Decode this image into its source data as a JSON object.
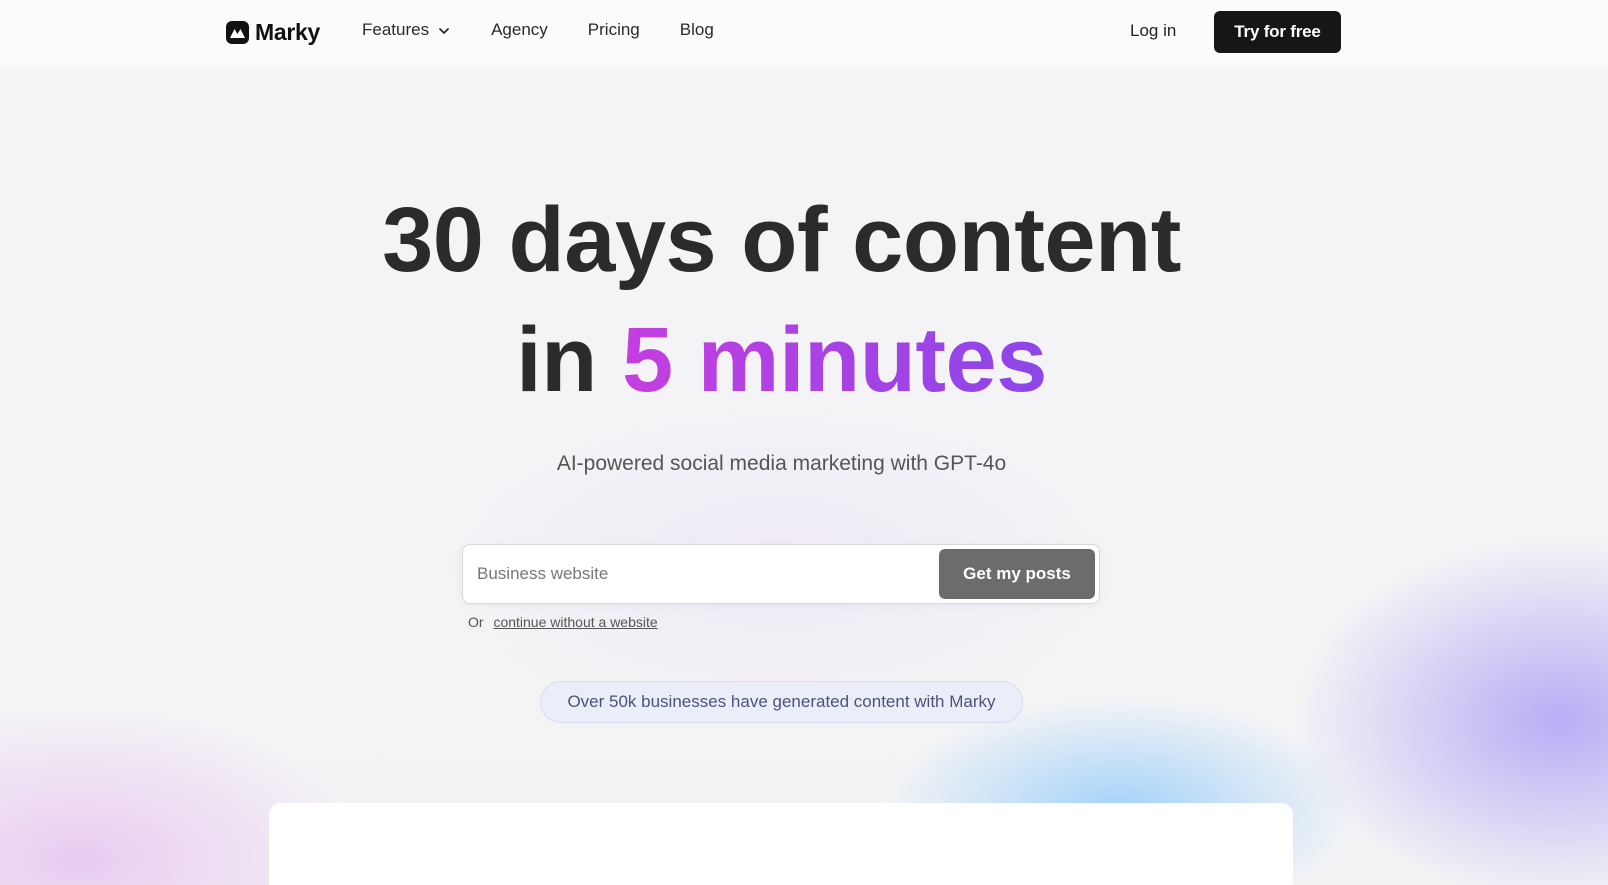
{
  "header": {
    "brand": "Marky",
    "nav": [
      {
        "label": "Features",
        "has_dropdown": true
      },
      {
        "label": "Agency"
      },
      {
        "label": "Pricing"
      },
      {
        "label": "Blog"
      }
    ],
    "login_label": "Log in",
    "cta_label": "Try for free"
  },
  "hero": {
    "line1": "30 days of content",
    "line2_prefix": "in",
    "line2_accent": "5 minutes",
    "subtitle": "AI-powered social media marketing with GPT-4o"
  },
  "form": {
    "website_placeholder": "Business website",
    "website_value": "",
    "submit_label": "Get my posts",
    "or_text": "Or",
    "alt_link": "continue without a website"
  },
  "social_proof": "Over 50k businesses have generated content with Marky",
  "colors": {
    "accent_start": "#c53ee0",
    "accent_end": "#8c46e8",
    "cta_bg": "#161616",
    "submit_bg": "#6c6c6c"
  },
  "icons": {
    "logo": "marky-logo-icon",
    "dropdown": "chevron-down-icon"
  }
}
